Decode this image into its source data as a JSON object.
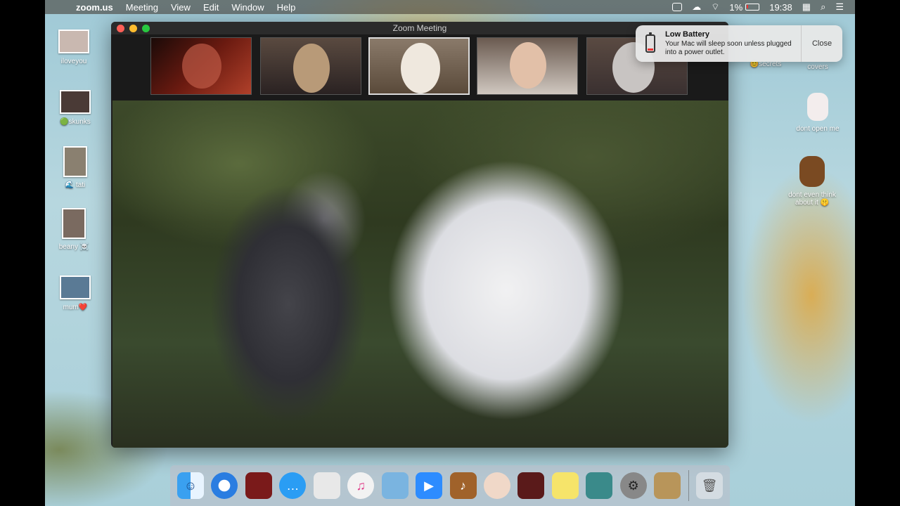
{
  "menubar": {
    "app_name": "zoom.us",
    "menus": [
      "Meeting",
      "View",
      "Edit",
      "Window",
      "Help"
    ],
    "battery_percent": "1%",
    "time": "19:38"
  },
  "desktop_left": [
    {
      "label": "iloveyou"
    },
    {
      "label": "🟢skunks"
    },
    {
      "label": "🌊 tati"
    },
    {
      "label": "beany ☠️"
    },
    {
      "label": "mum❤️"
    }
  ],
  "desktop_right": [
    {
      "label": "😊secrets"
    },
    {
      "label": "covers"
    },
    {
      "label": "dont open me"
    },
    {
      "label": "dont even think about it 🤫"
    }
  ],
  "zoom_window": {
    "title": "Zoom Meeting"
  },
  "notification": {
    "title": "Low Battery",
    "body": "Your Mac will sleep soon unless plugged into a power outlet.",
    "close_label": "Close"
  },
  "dock": {
    "items": [
      "finder-icon",
      "safari-icon",
      "photo-booth-icon",
      "messages-icon",
      "app-icon",
      "itunes-icon",
      "app-icon",
      "zoom-icon",
      "garageband-icon",
      "face-icon",
      "app-icon",
      "stickies-icon",
      "preview-icon",
      "system-preferences-icon",
      "contacts-icon",
      "trash-icon"
    ]
  }
}
